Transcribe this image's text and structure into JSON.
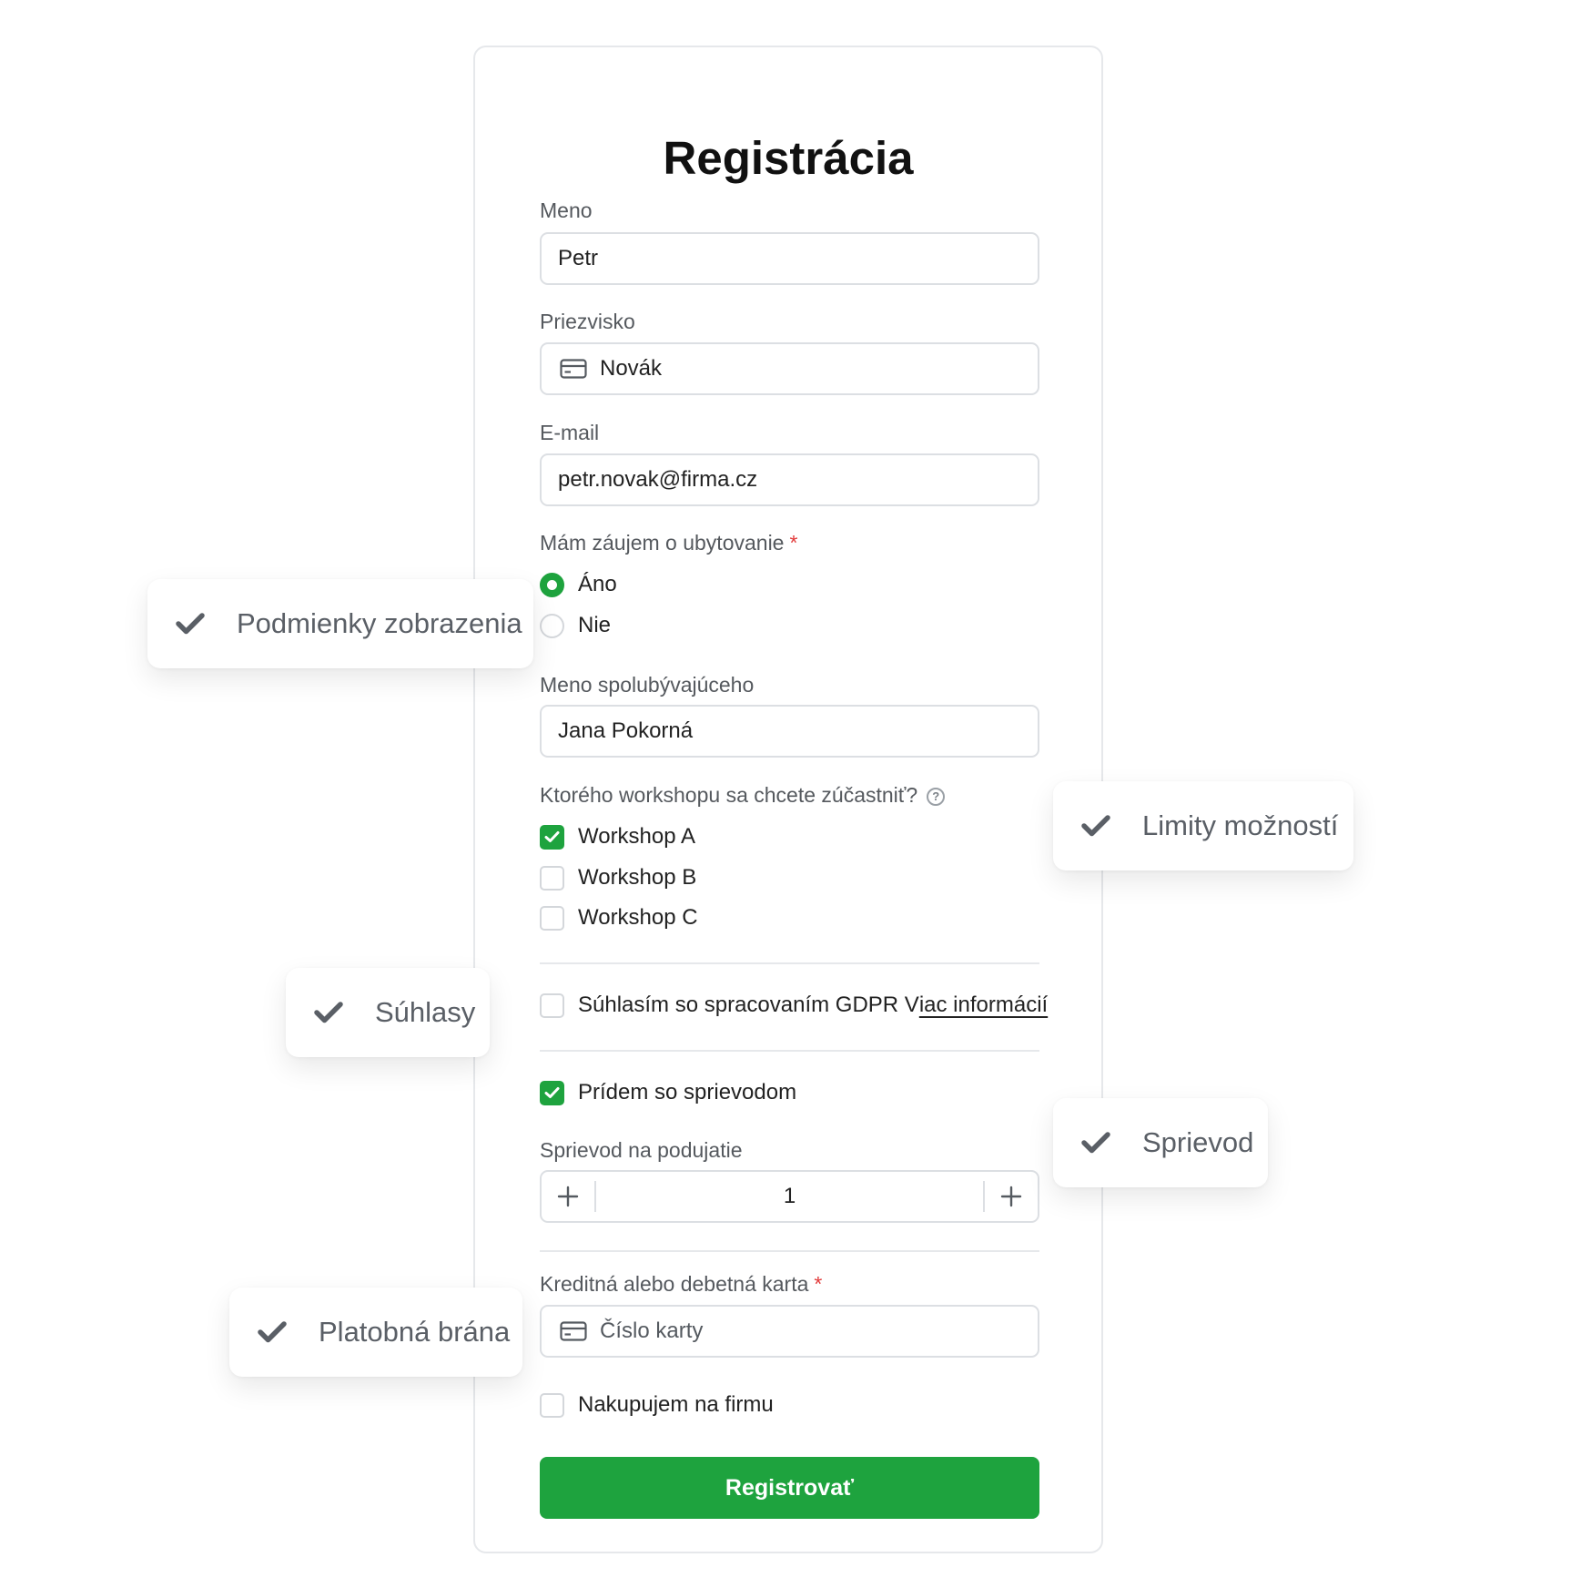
{
  "form": {
    "title": "Registrácia",
    "first_name": {
      "label": "Meno",
      "value": "Petr"
    },
    "last_name": {
      "label": "Priezvisko",
      "value": "Novák",
      "icon": "card-icon"
    },
    "email": {
      "label": "E-mail",
      "value": "petr.novak@firma.cz"
    },
    "accommodation": {
      "label": "Mám záujem o ubytovanie",
      "required_mark": "*",
      "options": [
        {
          "label": "Áno",
          "selected": true
        },
        {
          "label": "Nie",
          "selected": false
        }
      ]
    },
    "roommate": {
      "label": "Meno spolubývajúceho",
      "value": "Jana Pokorná"
    },
    "workshops": {
      "label": "Ktorého workshopu sa chcete zúčastniť?",
      "help_icon": "question-circle-icon",
      "options": [
        {
          "label": "Workshop A",
          "checked": true
        },
        {
          "label": "Workshop B",
          "checked": false
        },
        {
          "label": "Workshop C",
          "checked": false
        }
      ]
    },
    "gdpr": {
      "text": "Súhlasím so spracovaním GDPR V",
      "link": "iac informácií",
      "checked": false
    },
    "companion": {
      "label": "Prídem so sprievodom",
      "checked": true
    },
    "companion_count": {
      "label": "Sprievod na podujatie",
      "value": "1"
    },
    "card": {
      "label": "Kreditná alebo debetná karta",
      "required_mark": "*",
      "placeholder": "Číslo karty",
      "icon": "card-icon"
    },
    "company": {
      "label": "Nakupujem na firmu",
      "checked": false
    },
    "submit_label": "Registrovať"
  },
  "badges": [
    {
      "label": "Podmienky zobrazenia",
      "icon": "check-icon"
    },
    {
      "label": "Limity možností",
      "icon": "check-icon"
    },
    {
      "label": "Súhlasy",
      "icon": "check-icon"
    },
    {
      "label": "Sprievod",
      "icon": "check-icon"
    },
    {
      "label": "Platobná brána",
      "icon": "check-icon"
    }
  ],
  "colors": {
    "accent": "#1ea33e",
    "required": "#e23b3b",
    "border": "#dcdfe3"
  }
}
